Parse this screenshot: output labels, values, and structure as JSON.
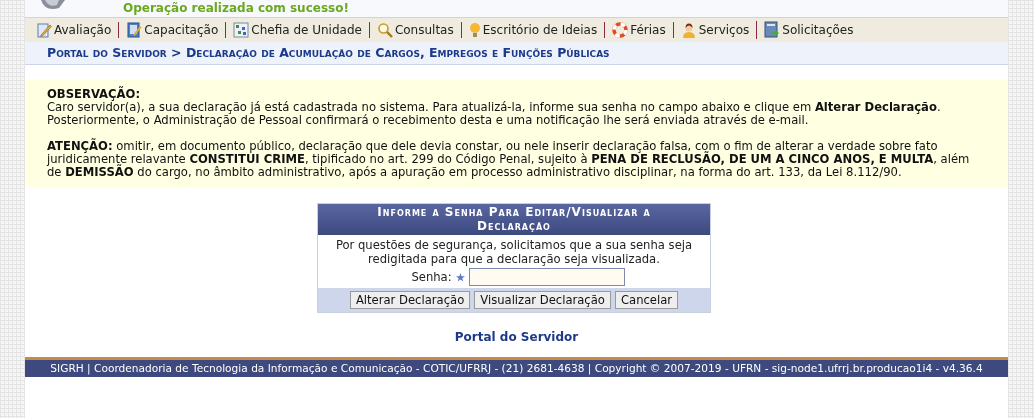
{
  "status_message": "Operação realizada com sucesso!",
  "menu": [
    {
      "label": "Avaliação",
      "kind": "evaluation"
    },
    {
      "label": "Capacitação",
      "kind": "training"
    },
    {
      "label": "Chefia de Unidade",
      "kind": "unit"
    },
    {
      "label": "Consultas",
      "kind": "search"
    },
    {
      "label": "Escritório de Ideias",
      "kind": "ideas"
    },
    {
      "label": "Férias",
      "kind": "vacation"
    },
    {
      "label": "Serviços",
      "kind": "services"
    },
    {
      "label": "Solicitações",
      "kind": "requests"
    }
  ],
  "breadcrumb": "Portal do Servidor > Declaração de Acumulação de Cargos, Empregos e Funções Públicas",
  "notice": {
    "paragraphs": [
      "**OBSERVAÇÃO:**",
      "Caro servidor(a), a sua declaração já está cadastrada no sistema. Para atualizá-la, informe sua senha no campo abaixo e clique em **Alterar Declaração**. Posteriormente, o Administração de Pessoal confirmará o recebimento desta e uma notificação lhe será enviada através de e-mail.",
      "**ATENÇÃO:** omitir, em documento público, declaração que dele devia constar, ou nele inserir declaração falsa, com o fim de alterar a verdade sobre fato juridicamente relavante **CONSTITUI CRIME**, tipificado no art. 299 do Código Penal, sujeito à **PENA DE RECLUSÃO, DE UM A CINCO ANOS, E MULTA**, além de **DEMISSÃO** do cargo, no âmbito administrativo, após a apuração em processo administrativo disciplinar, na forma do art. 133, da Lei 8.112/90."
    ]
  },
  "form": {
    "title": "Informe a Senha Para Editar/Visualizar a Declaração",
    "message": "Por questões de segurança, solicitamos que a sua senha seja redigitada para que a declaração seja visualizada.",
    "field_label": "Senha:",
    "required": true,
    "buttons": [
      "Alterar Declaração",
      "Visualizar Declaração",
      "Cancelar"
    ]
  },
  "home_link": "Portal do Servidor",
  "footer": "SIGRH | Coordenadoria de Tecnologia da Informação e Comunicação - COTIC/UFRRJ - (21) 2681-4638 | Copyright © 2007-2019 - UFRN - sig-node1.ufrrj.br.producao1i4 - v4.36.4"
}
